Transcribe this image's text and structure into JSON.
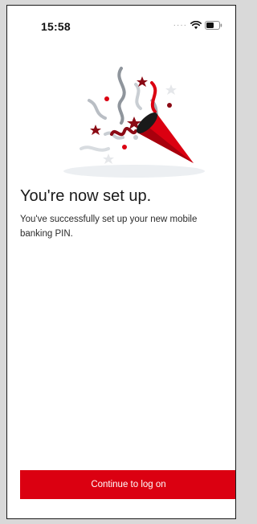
{
  "status_bar": {
    "time": "15:58",
    "signal_icon": "signal-dots",
    "wifi_icon": "wifi-icon",
    "battery_icon": "battery-icon"
  },
  "hero": {
    "icon": "party-popper-illustration"
  },
  "content": {
    "title": "You're now set up.",
    "message": "You've successfully set up your new mobile banking PIN."
  },
  "actions": {
    "continue_label": "Continue to log on"
  },
  "colors": {
    "brand_red": "#db0011",
    "dark_red": "#8b0a14",
    "text": "#1a1a1a"
  }
}
